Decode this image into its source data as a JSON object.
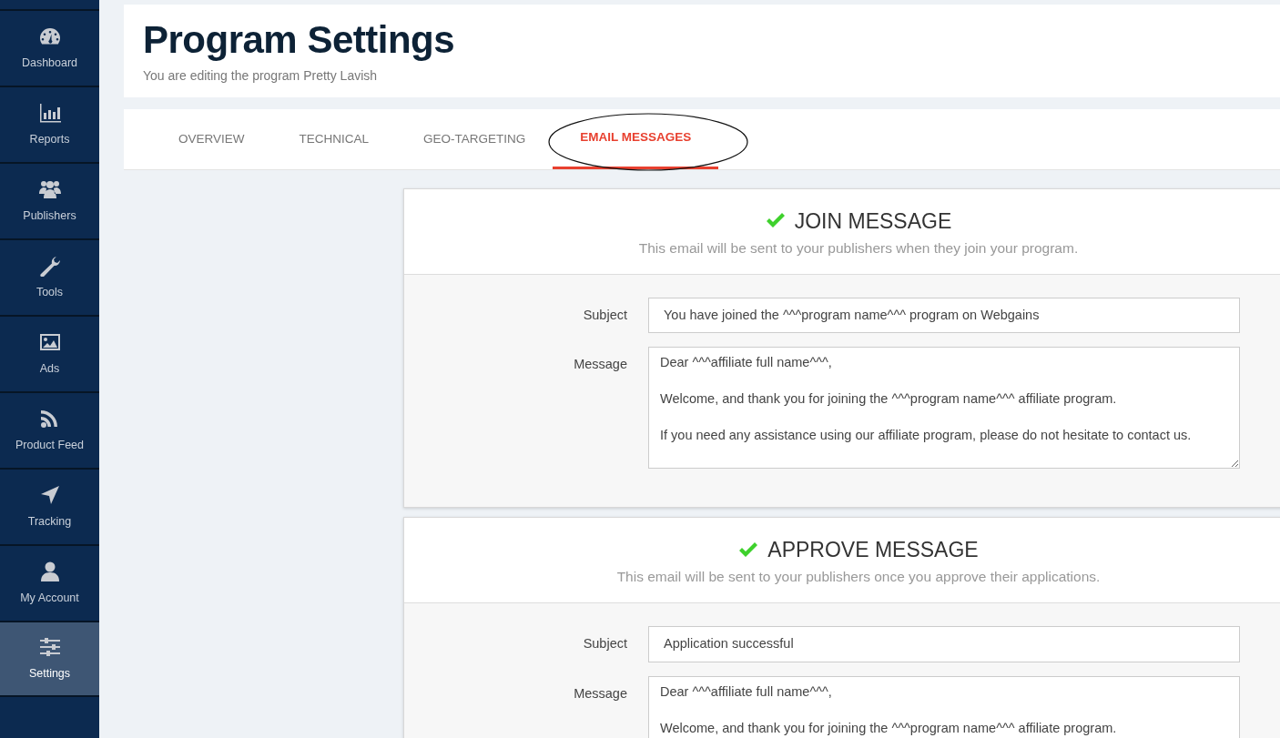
{
  "sidebar": {
    "items": [
      {
        "label": "Dashboard",
        "selected": false
      },
      {
        "label": "Reports",
        "selected": false
      },
      {
        "label": "Publishers",
        "selected": false
      },
      {
        "label": "Tools",
        "selected": false
      },
      {
        "label": "Ads",
        "selected": false
      },
      {
        "label": "Product Feed",
        "selected": false
      },
      {
        "label": "Tracking",
        "selected": false
      },
      {
        "label": "My Account",
        "selected": false
      },
      {
        "label": "Settings",
        "selected": true
      }
    ]
  },
  "header": {
    "title": "Program Settings",
    "subtitle": "You are editing the program Pretty Lavish"
  },
  "tabs": [
    {
      "label": "OVERVIEW",
      "selected": false,
      "circled": false
    },
    {
      "label": "TECHNICAL",
      "selected": false,
      "circled": false
    },
    {
      "label": "GEO-TARGETING",
      "selected": false,
      "circled": false
    },
    {
      "label": "EMAIL MESSAGES",
      "selected": true,
      "circled": true
    }
  ],
  "messages": [
    {
      "title": "JOIN MESSAGE",
      "description": "This email will be sent to your publishers when they join your program.",
      "enabled": true,
      "subject_label": "Subject",
      "subject": "You have joined the ^^^program name^^^ program on Webgains",
      "message_label": "Message",
      "message": [
        "Dear ^^^affiliate full name^^^,",
        "Welcome, and thank you for joining the ^^^program name^^^ affiliate program.",
        "If you need any assistance using our affiliate program, please do not hesitate to contact us."
      ]
    },
    {
      "title": "APPROVE MESSAGE",
      "description": "This email will be sent to your publishers once you approve their applications.",
      "enabled": true,
      "subject_label": "Subject",
      "subject": "Application successful",
      "message_label": "Message",
      "message": [
        "Dear ^^^affiliate full name^^^,",
        "Welcome, and thank you for joining the ^^^program name^^^ affiliate program."
      ]
    }
  ]
}
